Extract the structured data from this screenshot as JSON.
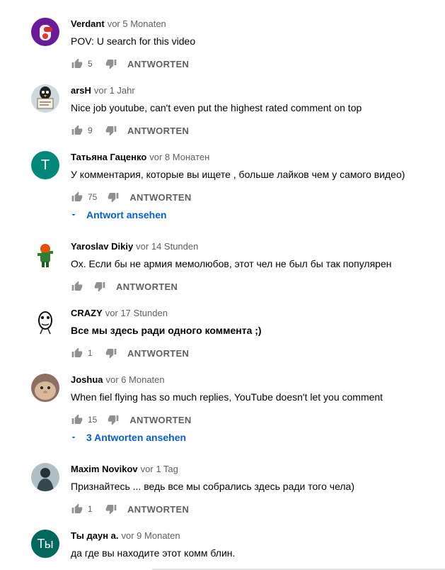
{
  "comments": [
    {
      "author": "Verdant",
      "time": "vor 5 Monaten",
      "text": "POV: U search for this video",
      "likes": "5",
      "reply": "ANTWORTEN",
      "avatar": "purple-amongus-avatar"
    },
    {
      "author": "arsH",
      "time": "vor 1 Jahr",
      "text": "Nice job youtube, can't even put the highest rated comment on top",
      "likes": "9",
      "reply": "ANTWORTEN",
      "avatar": "penguin-sign-avatar"
    },
    {
      "author": "Татьяна Гаценко",
      "time": "vor 8 Монатен",
      "text": "У комментария, которые вы ищете , больше лайков чем у самого видео)",
      "likes": "75",
      "reply": "ANTWORTEN",
      "avatar": "letter-avatar",
      "avatar_letter": "T",
      "view_replies": "Antwort ansehen"
    },
    {
      "author": "Yaroslav Dikiy",
      "time": "vor 14 Stunden",
      "text": "Ох. Если бы не армия мемолюбов, этот чел не был бы так популярен",
      "likes": "",
      "reply": "ANTWORTEN",
      "avatar": "green-character-avatar"
    },
    {
      "author": "CRAZY",
      "time": "vor 17 Stunden",
      "text": "Все мы здесь ради одного коммента ;)",
      "likes": "1",
      "reply": "ANTWORTEN",
      "avatar": "doodle-face-avatar"
    },
    {
      "author": "Joshua",
      "time": "vor 6 Monaten",
      "text": "When fiel flying has so much replies, YouTube doesn't let you comment",
      "likes": "15",
      "reply": "ANTWORTEN",
      "avatar": "hamster-avatar",
      "view_replies": "3 Antworten ansehen"
    },
    {
      "author": "Maxim Novikov",
      "time": "vor 1 Tag",
      "text": "Признайтесь ... ведь все мы собрались здесь ради того чела)",
      "likes": "1",
      "reply": "ANTWORTEN",
      "avatar": "dark-figure-avatar"
    },
    {
      "author": "Ты даун а.",
      "time": "vor 9 Monaten",
      "text": "да где вы находите этот комм блин.",
      "likes": "",
      "reply": "",
      "avatar": "letter-avatar",
      "avatar_letter": "Ты"
    }
  ],
  "colors": {
    "author": "#030303",
    "meta": "#606060",
    "link": "#065fd4",
    "teal_avatar": "#00897b",
    "dark_green_avatar": "#00695c"
  }
}
